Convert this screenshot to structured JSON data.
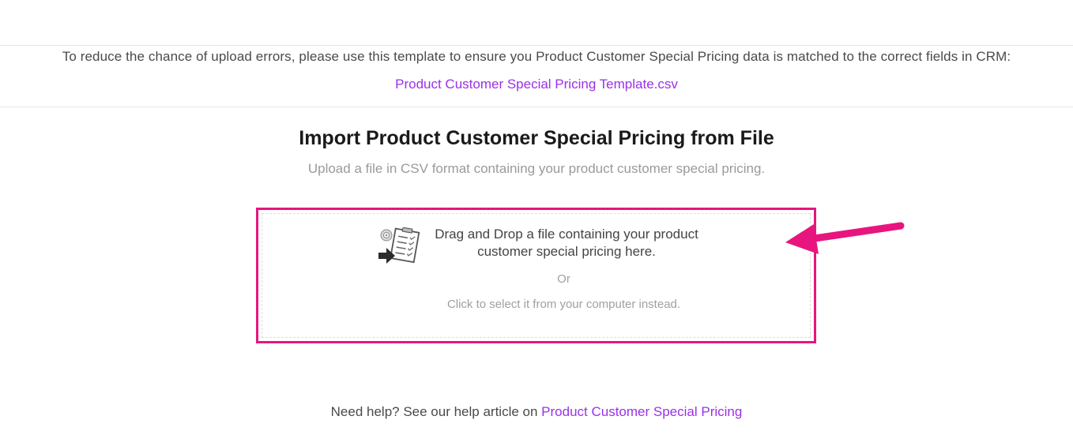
{
  "notice": {
    "text": "To reduce the chance of upload errors, please use this template to ensure you Product Customer Special Pricing data is matched to the correct fields in CRM:",
    "template_link": "Product Customer Special Pricing Template.csv"
  },
  "import": {
    "title": "Import Product Customer Special Pricing from File",
    "subtitle": "Upload a file in CSV format containing your product customer special pricing."
  },
  "dropzone": {
    "line1": "Drag and Drop a file containing your product",
    "line2": "customer special pricing here.",
    "or_text": "Or",
    "click_text": "Click to select it from your computer instead.",
    "icon": "file-upload-checklist-icon",
    "highlight_color": "#e8157e"
  },
  "annotation": {
    "icon": "arrow-left-icon",
    "color": "#e8157e"
  },
  "help": {
    "prefix": "Need help? See our help article on ",
    "link": "Product Customer Special Pricing"
  },
  "colors": {
    "link": "#9b30e8"
  }
}
